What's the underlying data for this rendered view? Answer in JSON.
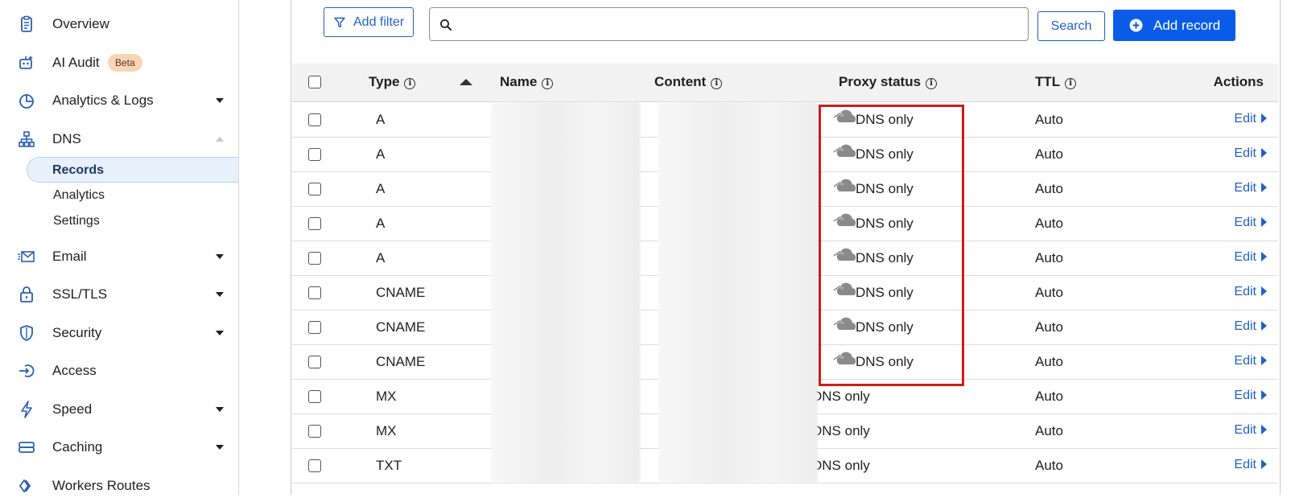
{
  "sidebar": {
    "items": [
      {
        "label": "Overview",
        "icon": "clipboard-icon",
        "caret": ""
      },
      {
        "label": "AI Audit",
        "icon": "robot-icon",
        "badge": "Beta",
        "caret": ""
      },
      {
        "label": "Analytics & Logs",
        "icon": "pie-chart-icon",
        "caret": "down"
      },
      {
        "label": "DNS",
        "icon": "network-tree-icon",
        "caret": "up"
      },
      {
        "label": "Email",
        "icon": "envelope-icon",
        "caret": "down"
      },
      {
        "label": "SSL/TLS",
        "icon": "lock-icon",
        "caret": "down"
      },
      {
        "label": "Security",
        "icon": "shield-icon",
        "caret": "down"
      },
      {
        "label": "Access",
        "icon": "login-arrow-icon",
        "caret": ""
      },
      {
        "label": "Speed",
        "icon": "lightning-icon",
        "caret": "down"
      },
      {
        "label": "Caching",
        "icon": "storage-icon",
        "caret": "down"
      },
      {
        "label": "Workers Routes",
        "icon": "workers-icon",
        "caret": ""
      }
    ],
    "dns_sub": [
      {
        "label": "Records",
        "active": true
      },
      {
        "label": "Analytics",
        "active": false
      },
      {
        "label": "Settings",
        "active": false
      }
    ]
  },
  "toolbar": {
    "filter_label": "Add filter",
    "search_placeholder": "",
    "search_value": "",
    "search_label": "Search",
    "add_label": "Add record"
  },
  "table": {
    "headers": {
      "type": "Type",
      "name": "Name",
      "content": "Content",
      "proxy": "Proxy status",
      "ttl": "TTL",
      "actions": "Actions"
    },
    "rows": [
      {
        "type": "A",
        "proxy": "DNS only",
        "cloud": true,
        "ttl": "Auto",
        "action": "Edit"
      },
      {
        "type": "A",
        "proxy": "DNS only",
        "cloud": true,
        "ttl": "Auto",
        "action": "Edit"
      },
      {
        "type": "A",
        "proxy": "DNS only",
        "cloud": true,
        "ttl": "Auto",
        "action": "Edit"
      },
      {
        "type": "A",
        "proxy": "DNS only",
        "cloud": true,
        "ttl": "Auto",
        "action": "Edit"
      },
      {
        "type": "A",
        "proxy": "DNS only",
        "cloud": true,
        "ttl": "Auto",
        "action": "Edit"
      },
      {
        "type": "CNAME",
        "proxy": "DNS only",
        "cloud": true,
        "ttl": "Auto",
        "action": "Edit"
      },
      {
        "type": "CNAME",
        "proxy": "DNS only",
        "cloud": true,
        "ttl": "Auto",
        "action": "Edit"
      },
      {
        "type": "CNAME",
        "proxy": "DNS only",
        "cloud": true,
        "ttl": "Auto",
        "action": "Edit"
      },
      {
        "type": "MX",
        "proxy": "DNS only",
        "cloud": false,
        "ttl": "Auto",
        "action": "Edit"
      },
      {
        "type": "MX",
        "proxy": "DNS only",
        "cloud": false,
        "ttl": "Auto",
        "action": "Edit"
      },
      {
        "type": "TXT",
        "proxy": "DNS only",
        "cloud": false,
        "ttl": "Auto",
        "action": "Edit"
      }
    ]
  },
  "colors": {
    "accent": "#0a5ce8",
    "link": "#1e61c9",
    "highlight": "#d11a1a",
    "cloud_gray": "#8a8a8a"
  }
}
